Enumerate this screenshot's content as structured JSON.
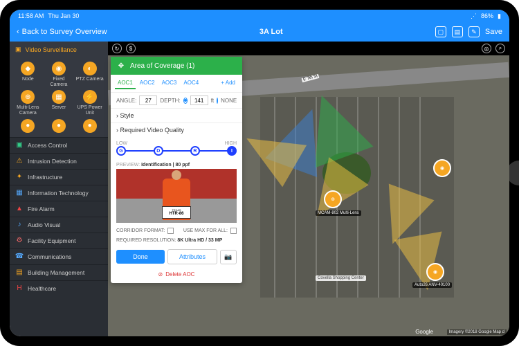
{
  "statusbar": {
    "time": "11:58 AM",
    "date": "Thu Jan 30",
    "battery": "86%",
    "wifi": "●●●"
  },
  "titlebar": {
    "back": "Back to Survey Overview",
    "title": "3A Lot",
    "save": "Save"
  },
  "sidebar": {
    "header": "Video Surveillance",
    "icons": [
      {
        "label": "Node"
      },
      {
        "label": "Fixed Camera"
      },
      {
        "label": "PTZ Camera"
      },
      {
        "label": "Multi-Lens Camera"
      },
      {
        "label": "Server"
      },
      {
        "label": "UPS Power Unit"
      }
    ],
    "categories": [
      "Access Control",
      "Intrusion Detection",
      "Infrastructure",
      "Information Technology",
      "Fire Alarm",
      "Audio Visual",
      "Facility Equipment",
      "Communications",
      "Building Management",
      "Healthcare"
    ]
  },
  "panel": {
    "title": "Area of Coverage (1)",
    "tabs": [
      "AOC1",
      "AOC2",
      "AOC3",
      "AOC4"
    ],
    "add": "+ Add",
    "angle_label": "ANGLE:",
    "angle": "27",
    "depth_label": "DEPTH:",
    "depth": "141",
    "unit": "ft",
    "none": "NONE",
    "style": "Style",
    "quality": "Required Video Quality",
    "q_low": "LOW",
    "q_high": "HIGH",
    "q_nodes": [
      "G",
      "D",
      "R",
      "I"
    ],
    "preview_label": "PREVIEW:",
    "preview_value": "Identification | 80 ppf",
    "plate_state": "TEXAS",
    "plate_num": "HTR-86",
    "corridor": "CORRIDOR FORMAT:",
    "usemax": "USE MAX FOR ALL:",
    "res_label": "REQUIRED RESOLUTION:",
    "res_value": "8K Ultra HD / 33 MP",
    "done": "Done",
    "attributes": "Attributes",
    "delete": "Delete AOC"
  },
  "map": {
    "street1": "E 7th St",
    "marker1": "MCAM-802 Multi-Lens",
    "marker2": "Covella Shopping Center",
    "marker3": "Auto26 ANV-40100",
    "google": "Google",
    "attrib": "Imagery ©2018 Google Map d"
  }
}
